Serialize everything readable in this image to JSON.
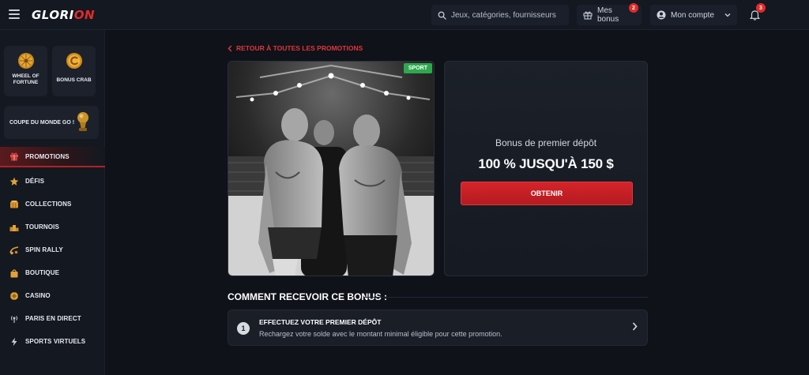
{
  "header": {
    "brand_prefix": "GLORI",
    "brand_accent": "ON",
    "search_placeholder": "Jeux, catégories, fournisseurs",
    "bonus_label": "Mes bonus",
    "bonus_count": "2",
    "account_label": "Mon compte",
    "notification_count": "3"
  },
  "sidebar": {
    "tiles": [
      {
        "label_line1": "WHEEL OF",
        "label_line2": "FORTUNE",
        "icon": "wheel-icon"
      },
      {
        "label_line1": "BONUS CRAB",
        "label_line2": "",
        "icon": "crab-coin-icon"
      }
    ],
    "world_cup_label": "COUPE DU MONDE GO !",
    "items": [
      {
        "label": "PROMOTIONS",
        "icon": "gift-icon",
        "active": true
      },
      {
        "label": "DÉFIS",
        "icon": "star-icon"
      },
      {
        "label": "COLLECTIONS",
        "icon": "cards-icon"
      },
      {
        "label": "TOURNOIS",
        "icon": "podium-icon"
      },
      {
        "label": "SPIN RALLY",
        "icon": "rally-icon"
      },
      {
        "label": "BOUTIQUE",
        "icon": "shop-bag-icon"
      },
      {
        "label": "CASINO",
        "icon": "chip-icon"
      },
      {
        "label": "PARIS EN DIRECT",
        "icon": "live-icon"
      },
      {
        "label": "SPORTS VIRTUELS",
        "icon": "lightning-icon"
      }
    ]
  },
  "main": {
    "back_label": "RETOUR À TOUTES LES PROMOTIONS",
    "promo_tag": "SPORT",
    "offer_subtitle": "Bonus de premier dépôt",
    "offer_title": "100 % JUSQU'À 150 $",
    "cta_label": "OBTENIR",
    "howto_title": "COMMENT RECEVOIR CE BONUS :",
    "steps": [
      {
        "number": "1",
        "title": "EFFECTUEZ VOTRE PREMIER DÉPÔT",
        "description": "Rechargez votre solde avec le montant minimal éligible pour cette promotion."
      }
    ]
  },
  "colors": {
    "accent": "#e32b2b",
    "sport_tag": "#2ea84e",
    "background": "#0f1219",
    "panel": "#141821"
  }
}
